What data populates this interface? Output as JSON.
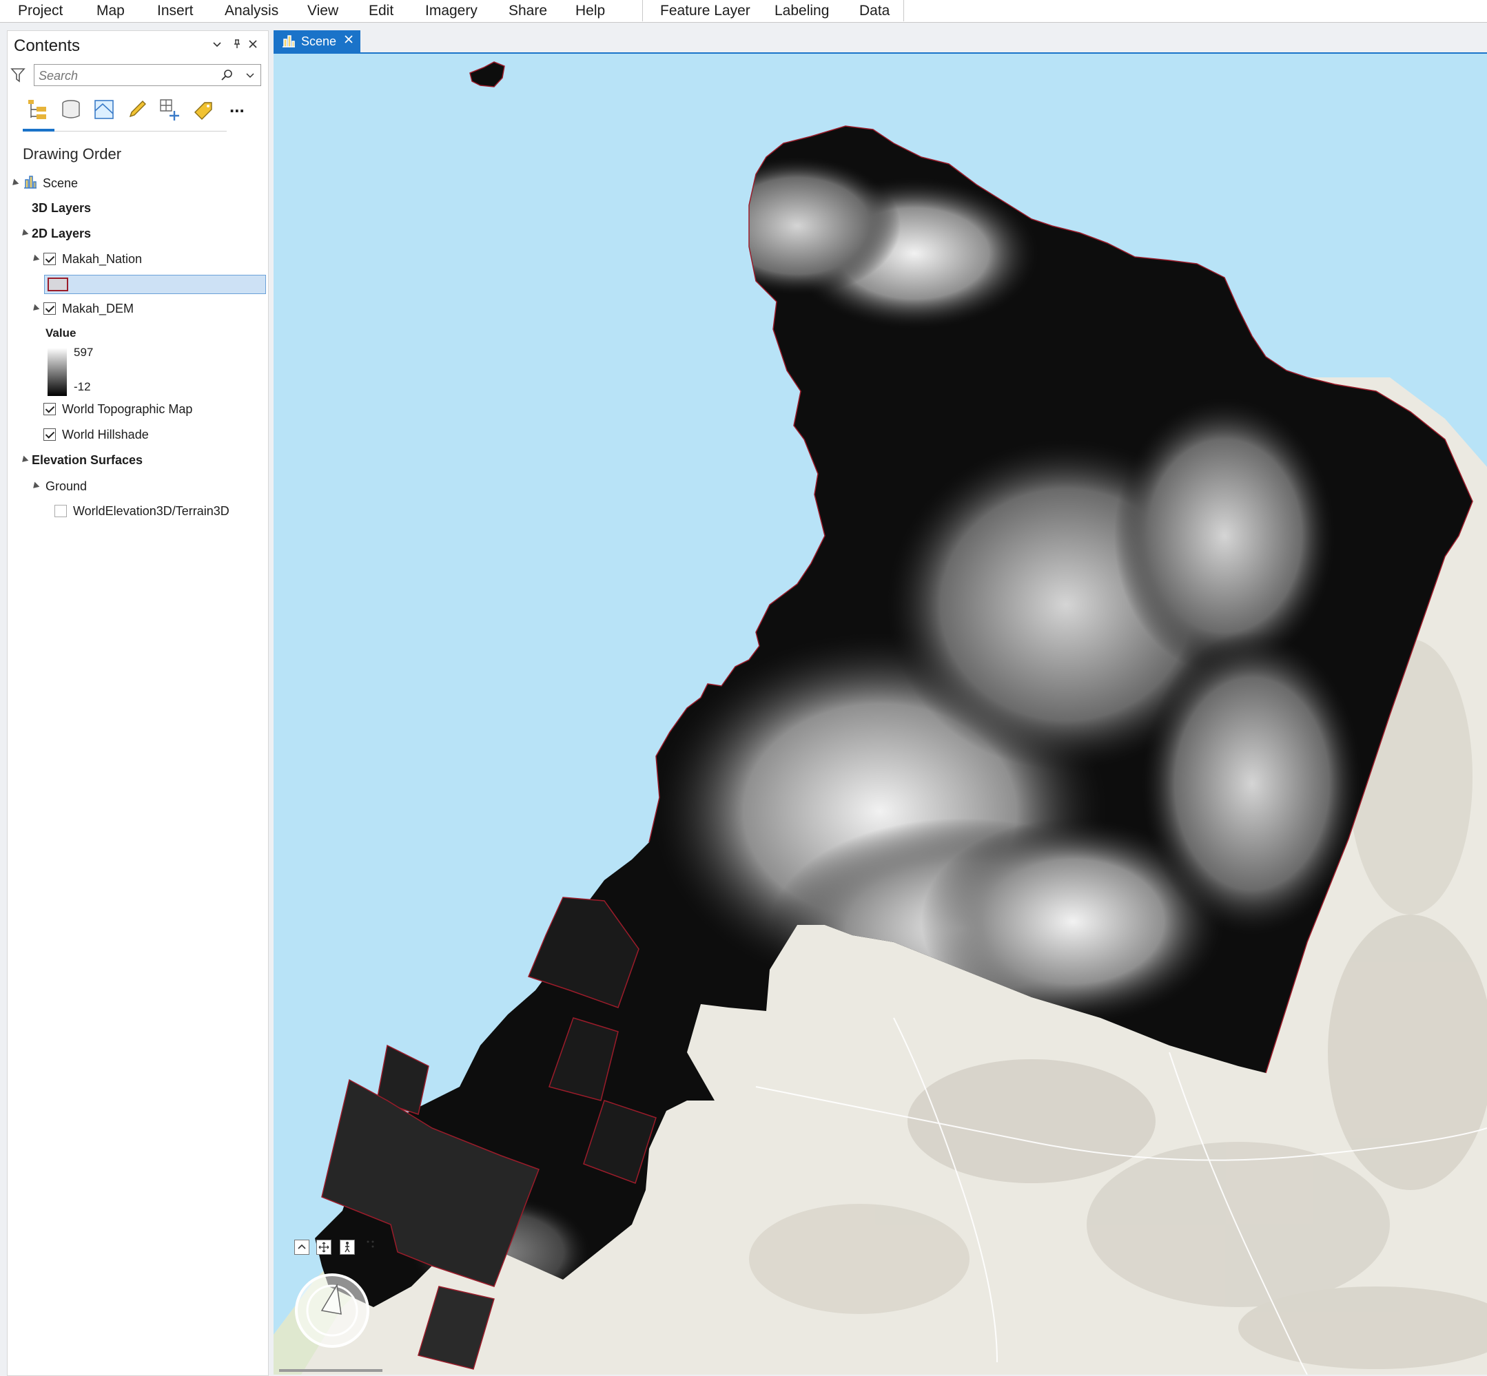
{
  "ribbon": {
    "menus": [
      "Project",
      "Map",
      "Insert",
      "Analysis",
      "View",
      "Edit",
      "Imagery",
      "Share",
      "Help"
    ],
    "contextual_tabs": [
      "Feature Layer",
      "Labeling",
      "Data"
    ]
  },
  "contents": {
    "title": "Contents",
    "search_placeholder": "Search",
    "toolbar_icons": [
      "drawing-order-icon",
      "data-source-icon",
      "selection-icon",
      "editing-icon",
      "snapping-icon",
      "labeling-icon",
      "more-icon"
    ],
    "more_label": "...",
    "section_title": "Drawing Order",
    "tree": {
      "scene": "Scene",
      "layers_3d": "3D Layers",
      "layers_2d": "2D Layers",
      "makah_nation": "Makah_Nation",
      "makah_dem": "Makah_DEM",
      "legend_label": "Value",
      "legend_high": "597",
      "legend_low": "-12",
      "world_topo": "World Topographic Map",
      "world_hillshade": "World Hillshade",
      "elevation_surfaces": "Elevation Surfaces",
      "ground": "Ground",
      "world_elevation": "WorldElevation3D/Terrain3D"
    },
    "checked": {
      "makah_nation": true,
      "makah_dem": true,
      "world_topo": true,
      "world_hillshade": true,
      "world_elevation": false
    }
  },
  "view": {
    "tab_label": "Scene",
    "colors": {
      "water": "#b8e3f7",
      "land": "#ebe9e1",
      "dem_dark": "#0d0d0d",
      "dem_light": "#f2f2f2",
      "boundary": "#9b1c2a",
      "accent": "#1a73c9"
    }
  }
}
